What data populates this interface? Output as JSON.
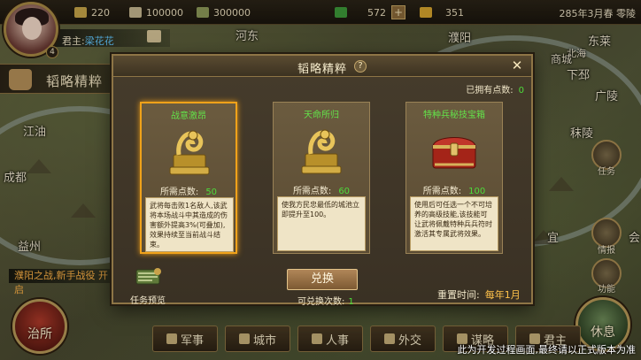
{
  "top_bar": {
    "resources": [
      {
        "icon": "gold-ingot-icon",
        "value": "220"
      },
      {
        "icon": "grain-sack-icon",
        "value": "100000"
      },
      {
        "icon": "wood-icon",
        "value": "300000"
      }
    ],
    "currency": {
      "value": "572",
      "add_label": "+"
    },
    "token": {
      "value": "351"
    },
    "date": "285年3月春 零陵"
  },
  "player": {
    "lord_label": "君主:",
    "lord_name": "梁花花",
    "level": "4"
  },
  "side_panel": {
    "title": "韬略精粹"
  },
  "map_labels": [
    "河东",
    "濮阳",
    "东莱",
    "北海",
    "商城",
    "下邳",
    "江油",
    "成都",
    "广陵",
    "秣陵",
    "益州",
    "宜",
    "会"
  ],
  "quest": {
    "text": "濮阳之战,新手战役 开启"
  },
  "right_menu": [
    "任务",
    "情报",
    "功能"
  ],
  "round_buttons": {
    "left": "治所",
    "right": "休息"
  },
  "bottom_nav": [
    "军事",
    "城市",
    "人事",
    "外交",
    "谋略",
    "君主"
  ],
  "dialog": {
    "title": "韬略精粹",
    "help_icon": "?",
    "close_icon": "✕",
    "owned_label": "已拥有点数:",
    "owned_value": "0",
    "cost_label": "所需点数:",
    "cards": [
      {
        "name": "战意激昂",
        "art": "golden-seal-icon",
        "cost": "50",
        "desc": "武将每击败1名敌人,该武将本场战斗中其造成的伤害额外提高3%(可叠加),效果持续至当前战斗结束。"
      },
      {
        "name": "天命所归",
        "art": "golden-seal-icon",
        "cost": "60",
        "desc": "使我方民忠最低的城池立即提升至100。"
      },
      {
        "name": "特种兵秘技宝箱",
        "art": "treasure-chest-icon",
        "cost": "100",
        "desc": "使用后可任选一个不可培养的高级技能,该技能可让武将佩戴特种兵兵符时激活其专属武将效果。"
      }
    ],
    "exchange_label": "兑换",
    "exchange_count_label": "可兑换次数:",
    "exchange_count_value": "1",
    "reset_label": "重置时间:",
    "reset_value": "每年1月",
    "task_preview_label": "任务预览"
  },
  "watermark": "此为开发过程画面,最终请以正式版本为准"
}
